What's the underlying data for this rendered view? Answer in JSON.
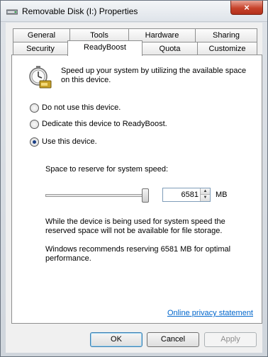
{
  "window": {
    "title": "Removable Disk (I:) Properties",
    "close_symbol": "×"
  },
  "tabs": {
    "row1": [
      "General",
      "Tools",
      "Hardware",
      "Sharing"
    ],
    "row2": [
      "Security",
      "ReadyBoost",
      "Quota",
      "Customize"
    ],
    "active": "ReadyBoost"
  },
  "panel": {
    "icon": "readyboost-icon",
    "intro": "Speed up your system by utilizing the available space on this device.",
    "options": [
      {
        "label": "Do not use this device.",
        "checked": false
      },
      {
        "label": "Dedicate this device to ReadyBoost.",
        "checked": false
      },
      {
        "label": "Use this device.",
        "checked": true
      }
    ],
    "reserve_label": "Space to reserve for system speed:",
    "slider_level": 1.0,
    "reserve_value": "6581",
    "unit": "MB",
    "note_storage": "While the device is being used for system speed the reserved space will not be available for file storage.",
    "note_recommend": "Windows recommends reserving 6581 MB for optimal performance.",
    "privacy_link": "Online privacy statement"
  },
  "buttons": {
    "ok": "OK",
    "cancel": "Cancel",
    "apply": "Apply"
  }
}
